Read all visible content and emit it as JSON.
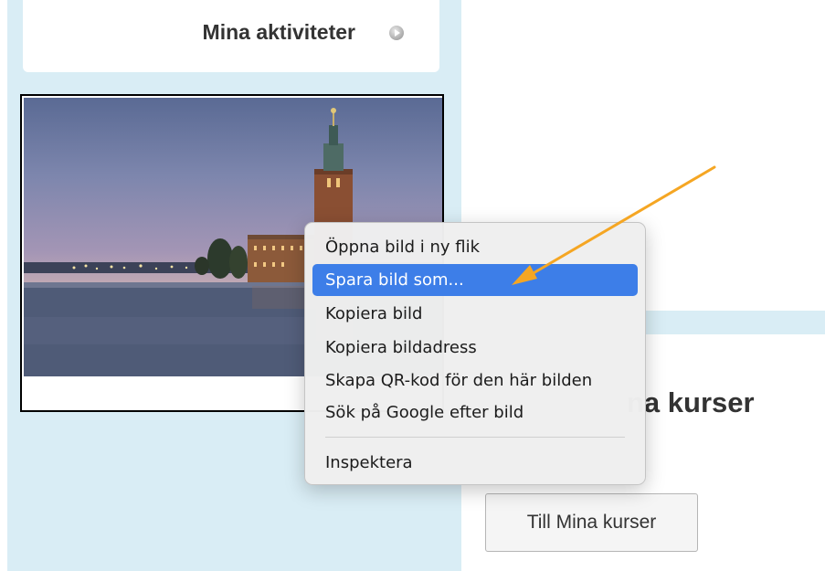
{
  "activities": {
    "title": "Mina aktiviteter"
  },
  "section": {
    "heading_partial": "na kurser",
    "button_label": "Till Mina kurser"
  },
  "context_menu": {
    "items": [
      {
        "label": "Öppna bild i ny flik",
        "highlighted": false
      },
      {
        "label": "Spara bild som...",
        "highlighted": true
      },
      {
        "label": "Kopiera bild",
        "highlighted": false
      },
      {
        "label": "Kopiera bildadress",
        "highlighted": false
      },
      {
        "label": "Skapa QR-kod för den här bilden",
        "highlighted": false
      },
      {
        "label": "Sök på Google efter bild",
        "highlighted": false
      },
      {
        "label": "Inspektera",
        "highlighted": false
      }
    ]
  },
  "colors": {
    "panel_bg": "#d9edf5",
    "menu_highlight": "#3d7ee8",
    "annotation_arrow": "#f5a623"
  }
}
